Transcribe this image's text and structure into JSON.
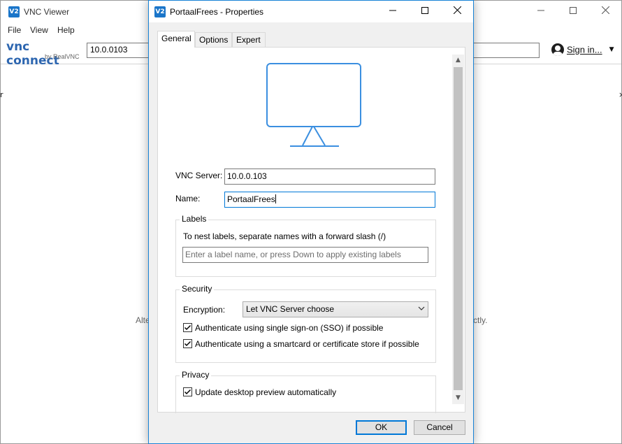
{
  "app_window": {
    "title": "VNC Viewer",
    "icon": "vnc-viewer-icon",
    "icon_text": "V2",
    "menu": [
      "File",
      "View",
      "Help"
    ],
    "logo": {
      "main": "vnc connect",
      "sub": "by RealVNC"
    },
    "address_value": "10.0.0103",
    "sign_in_label": "Sign in...",
    "hint_left": "Alte",
    "hint_right": "ctly."
  },
  "dialog": {
    "title": "PortaalFrees - Properties",
    "icon_text": "V2",
    "tabs": [
      {
        "label": "General",
        "active": true
      },
      {
        "label": "Options",
        "active": false
      },
      {
        "label": "Expert",
        "active": false
      }
    ],
    "illustration": "monitor-icon",
    "vnc_server": {
      "label": "VNC Server:",
      "value": "10.0.0.103"
    },
    "name": {
      "label": "Name:",
      "value": "PortaalFrees"
    },
    "labels_group": {
      "title": "Labels",
      "instructions": "To nest labels, separate names with a forward slash (/)",
      "placeholder": "Enter a label name, or press Down to apply existing labels"
    },
    "security_group": {
      "title": "Security",
      "encryption_label": "Encryption:",
      "encryption_value": "Let VNC Server choose",
      "sso": {
        "label": "Authenticate using single sign-on (SSO) if possible",
        "checked": true
      },
      "smartcard": {
        "label": "Authenticate using a smartcard or certificate store if possible",
        "checked": true
      }
    },
    "privacy_group": {
      "title": "Privacy",
      "preview": {
        "label": "Update desktop preview automatically",
        "checked": true
      }
    },
    "buttons": {
      "ok": "OK",
      "cancel": "Cancel"
    }
  },
  "colors": {
    "accent": "#0078d7",
    "brand": "#1a75c9",
    "illustration": "#3b8fe0"
  }
}
